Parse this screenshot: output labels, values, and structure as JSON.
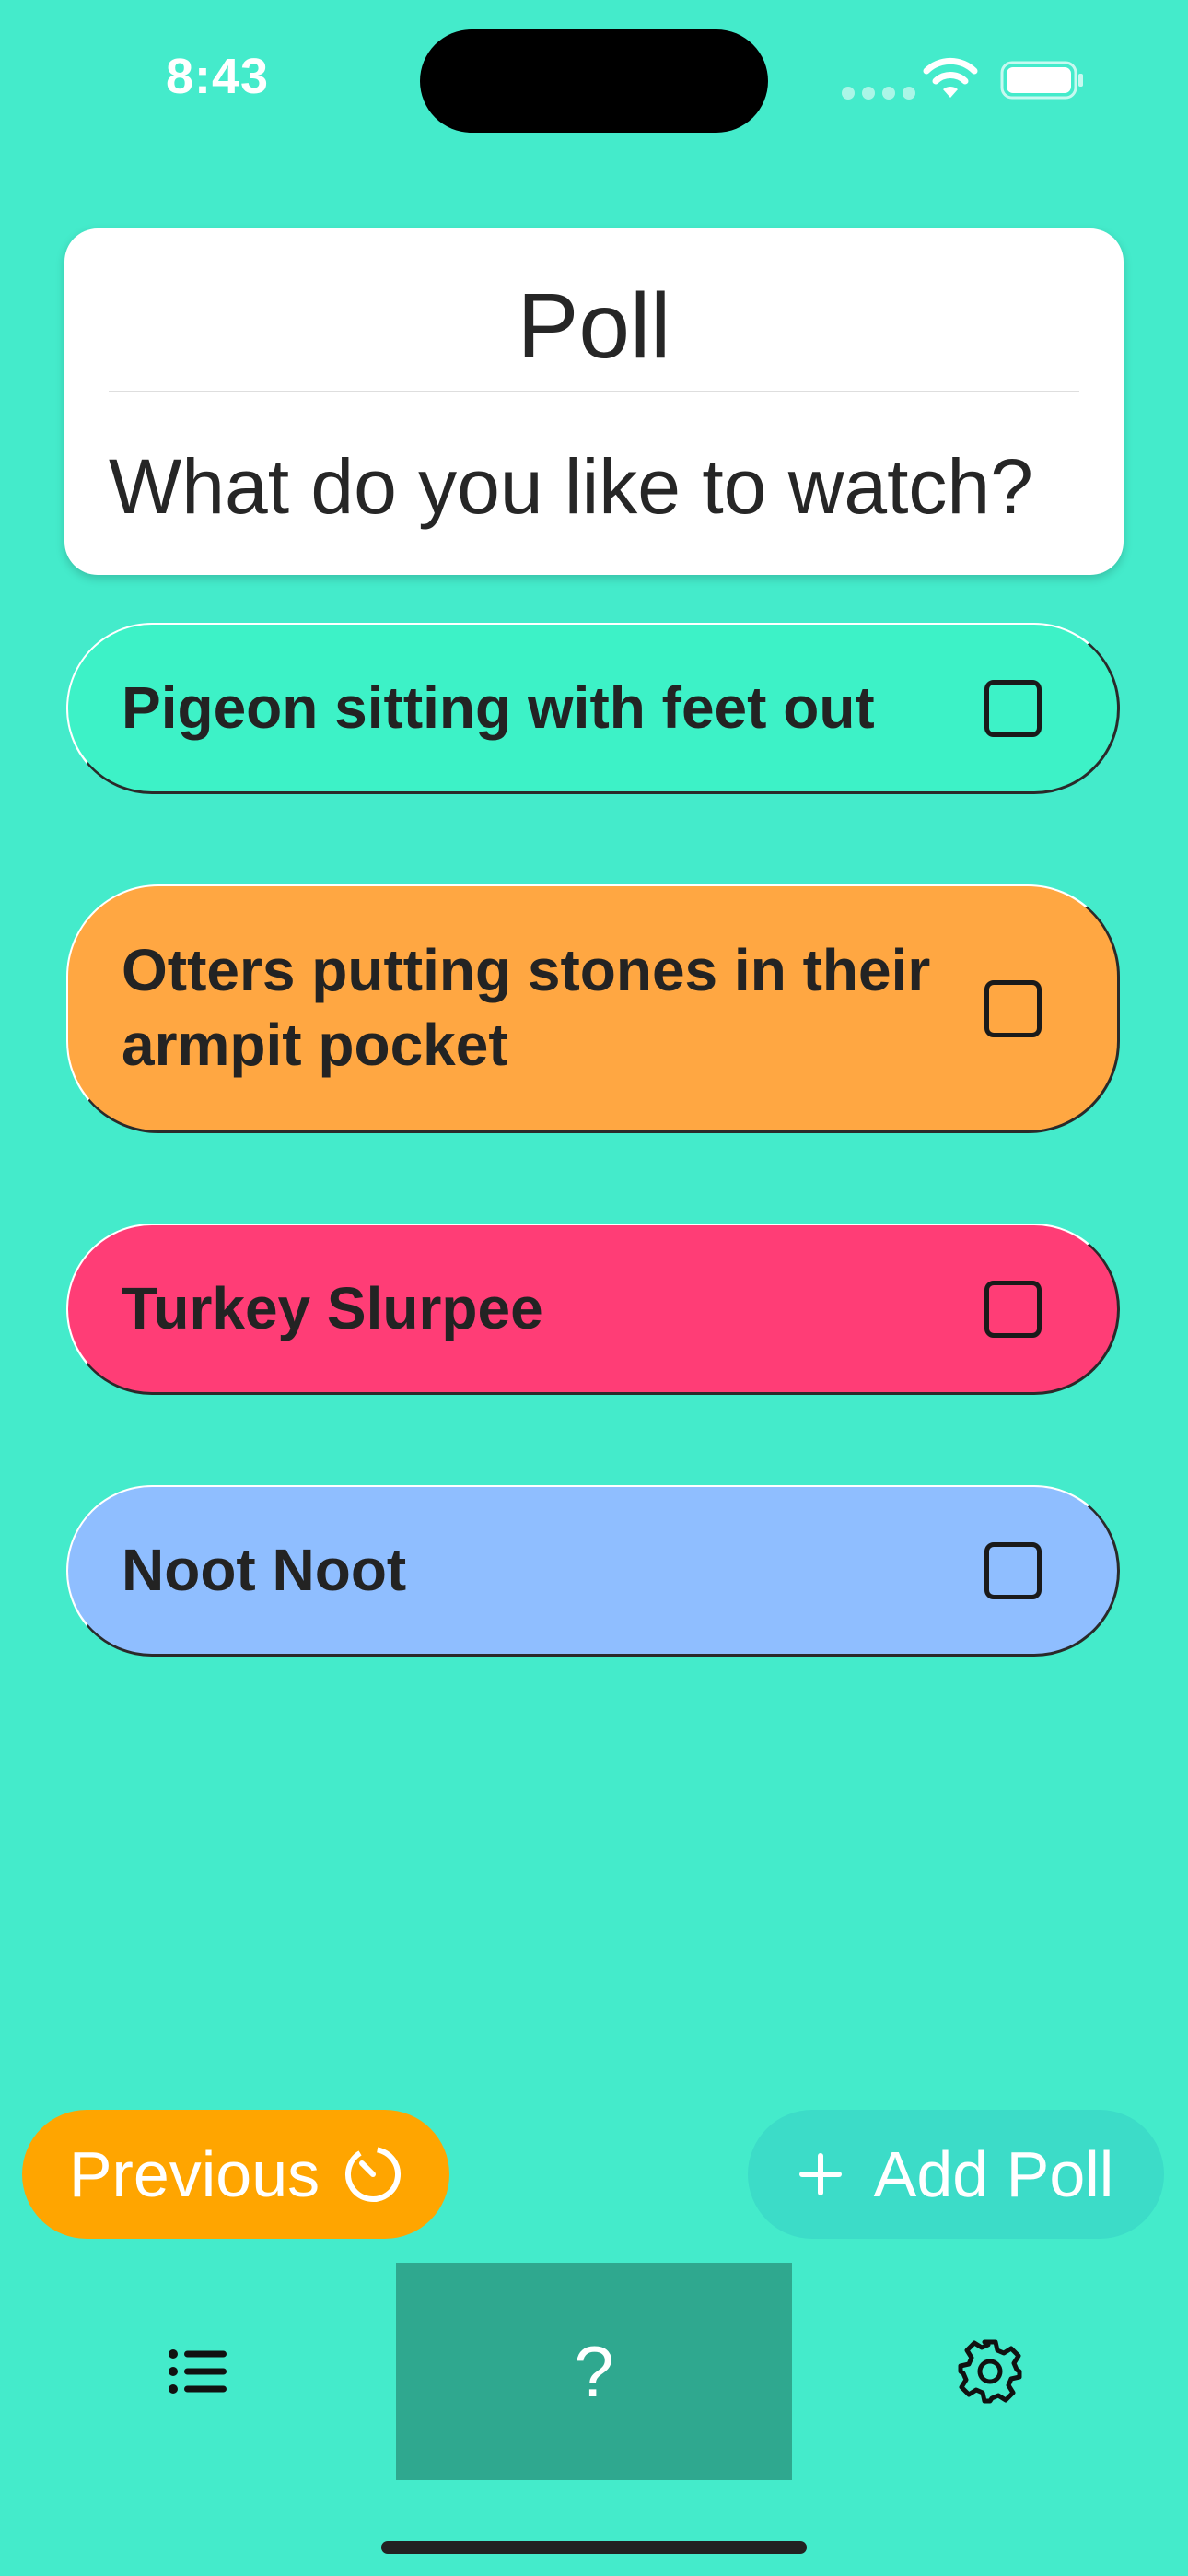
{
  "status_bar": {
    "time": "8:43"
  },
  "poll": {
    "title": "Poll",
    "question": "What do you like to watch?"
  },
  "options": [
    {
      "label": "Pigeon sitting with feet out",
      "color": "#3DF2C7",
      "checked": false
    },
    {
      "label": "Otters putting stones in their armpit pocket",
      "color": "#FFA742",
      "checked": false
    },
    {
      "label": "Turkey Slurpee",
      "color": "#FF3D76",
      "checked": false
    },
    {
      "label": "Noot Noot",
      "color": "#8FBEFF",
      "checked": false
    }
  ],
  "buttons": {
    "previous_label": "Previous",
    "previous_icon": "timer-icon",
    "add_poll_label": "Add Poll",
    "add_poll_icon": "plus-icon"
  },
  "tab_bar": {
    "left_icon": "list-icon",
    "center_glyph": "?",
    "right_icon": "gear-icon",
    "selected": "center"
  },
  "colors": {
    "background": "#44EBCB",
    "previous_button": "#FFA500",
    "add_poll_button": "#3CDCC8",
    "selected_tab": "#2FA88F"
  }
}
